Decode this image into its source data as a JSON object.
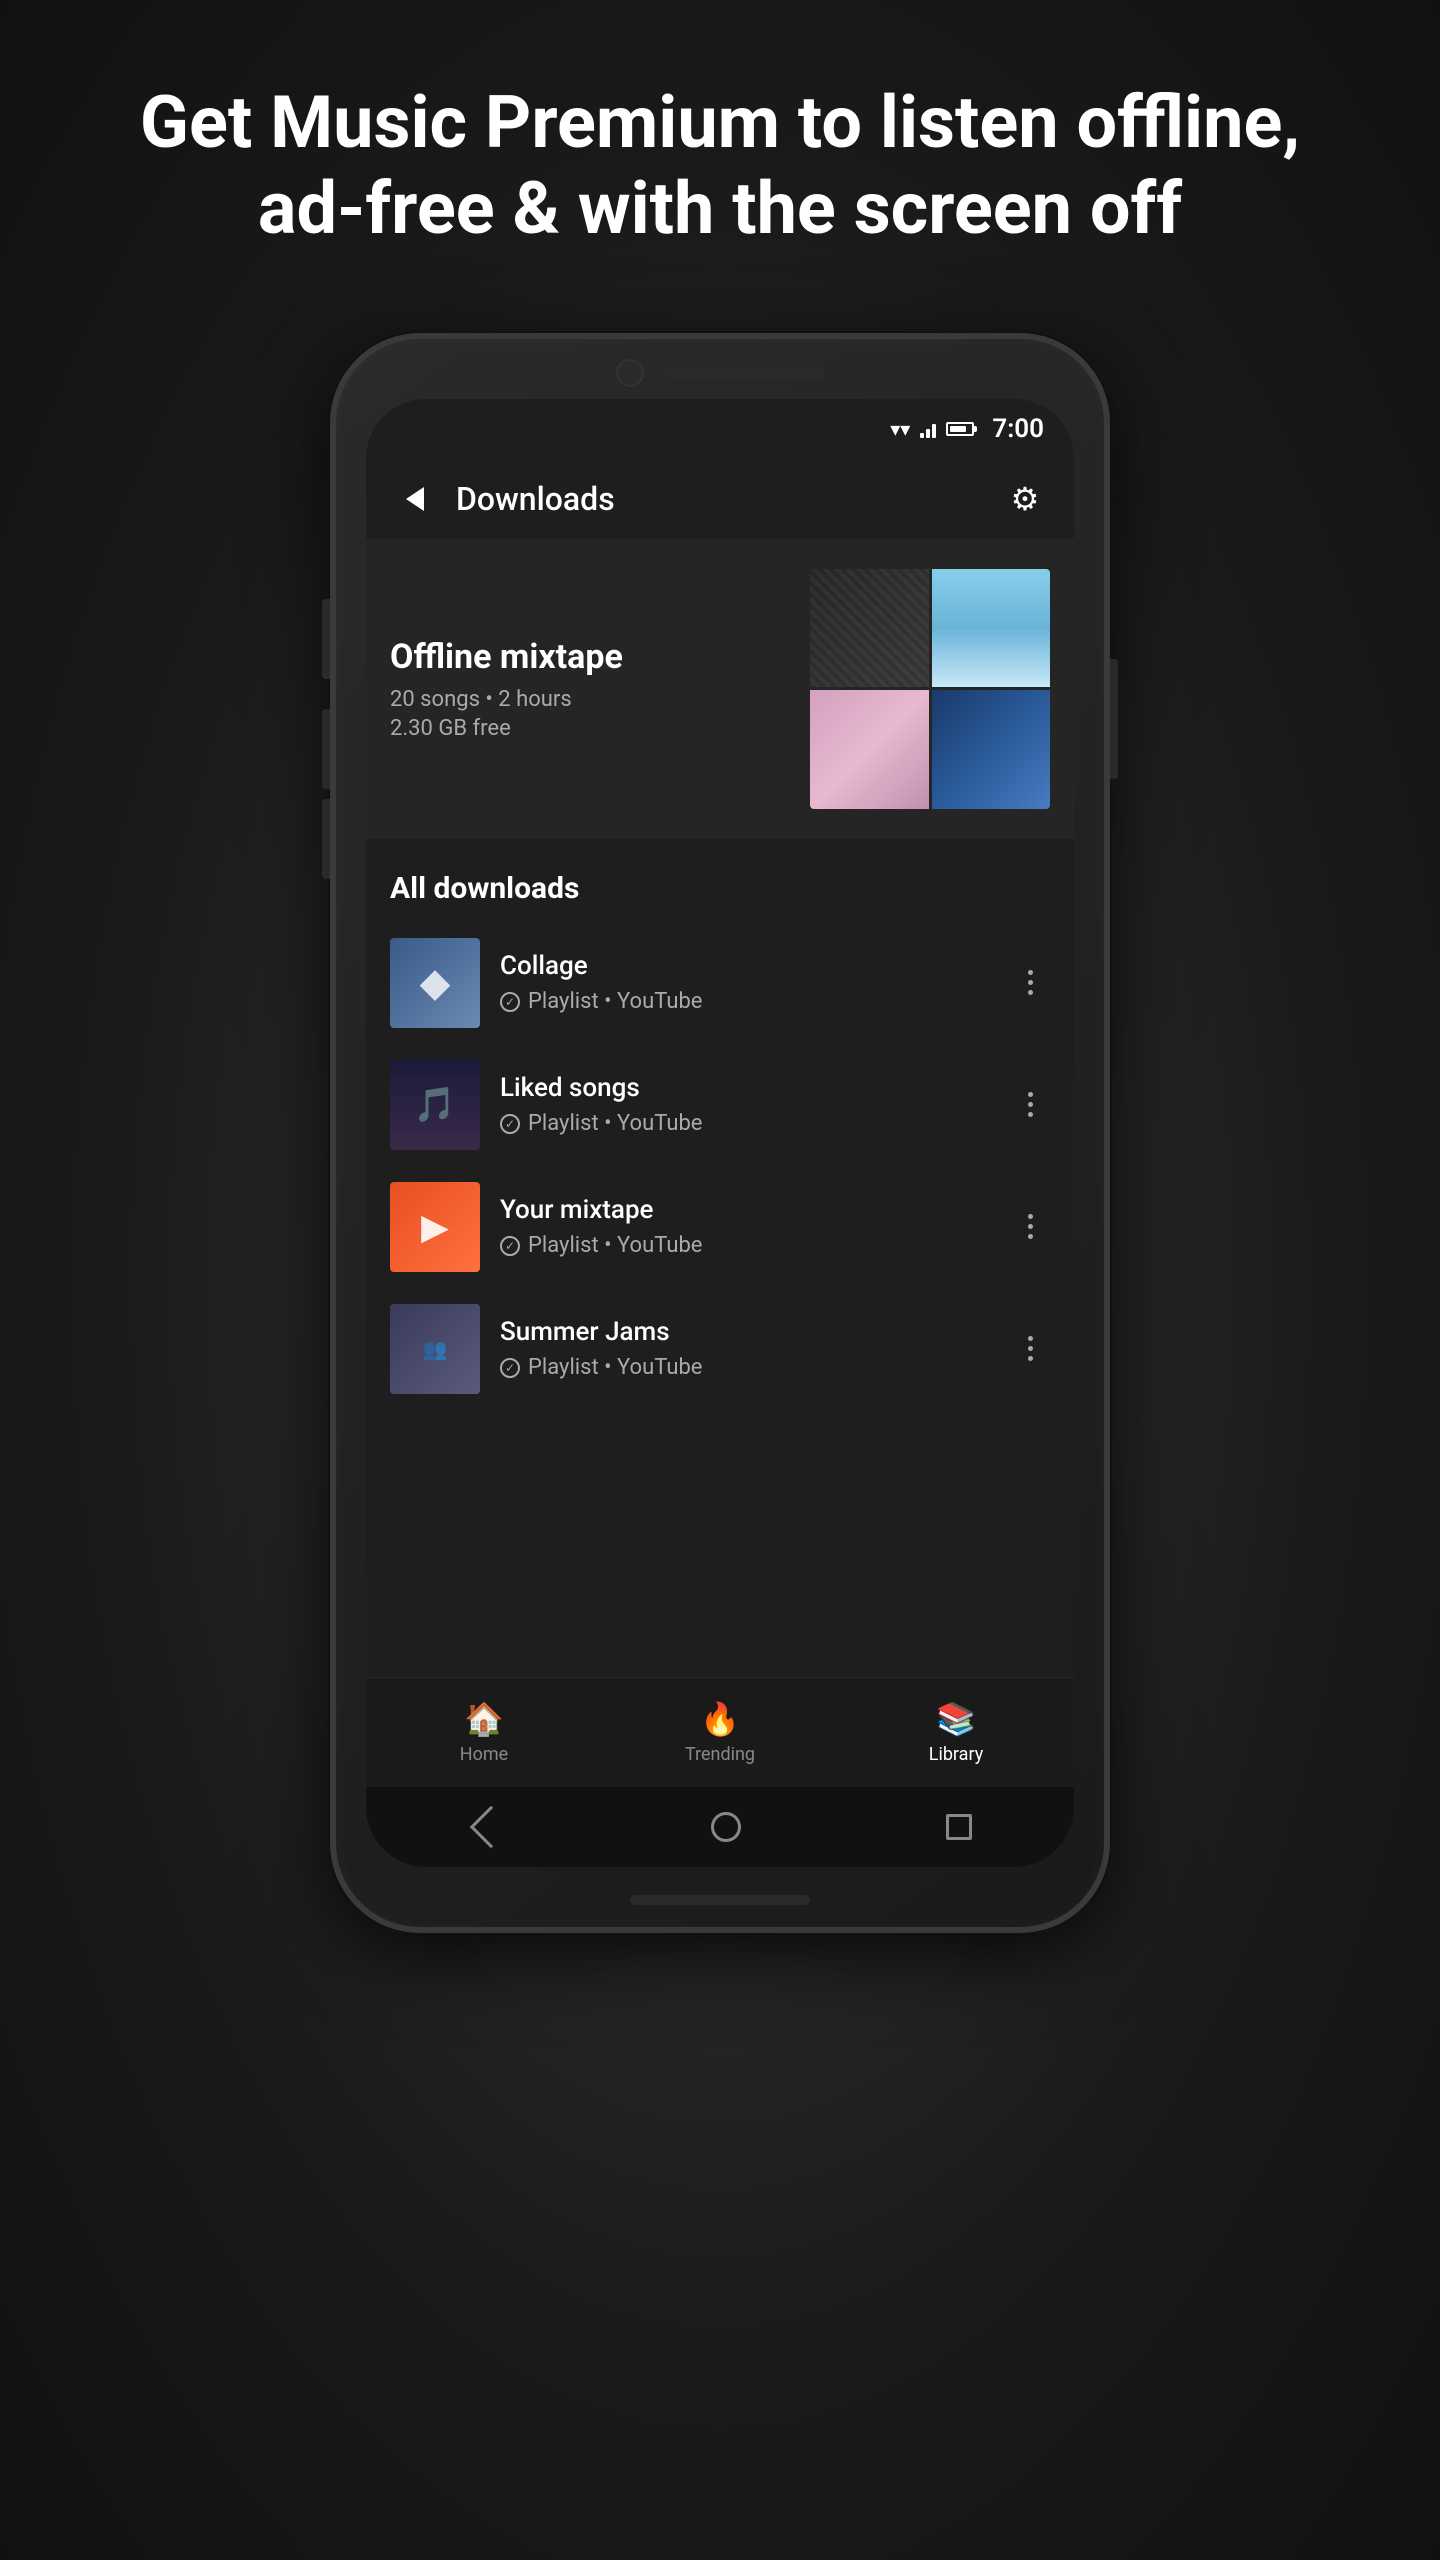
{
  "headline": "Get Music Premium to listen offline, ad-free & with the screen off",
  "status_bar": {
    "time": "7:00"
  },
  "header": {
    "title": "Downloads",
    "back_label": "back",
    "settings_label": "settings"
  },
  "offline_mixtape": {
    "title": "Offline mixtape",
    "songs": "20 songs",
    "duration": "2 hours",
    "storage": "2.30 GB free",
    "meta": "20 songs • 2 hours"
  },
  "all_downloads": {
    "section_title": "All downloads",
    "items": [
      {
        "name": "Collage",
        "sub": "Playlist • YouTube",
        "type": "collage"
      },
      {
        "name": "Liked songs",
        "sub": "Playlist • YouTube",
        "type": "liked"
      },
      {
        "name": "Your mixtape",
        "sub": "Playlist • YouTube",
        "type": "mixtape"
      },
      {
        "name": "Summer Jams",
        "sub": "Playlist • YouTube",
        "type": "summer"
      }
    ]
  },
  "bottom_nav": {
    "items": [
      {
        "label": "Home",
        "icon": "🏠",
        "active": false
      },
      {
        "label": "Trending",
        "icon": "🔥",
        "active": false
      },
      {
        "label": "Library",
        "icon": "📚",
        "active": true
      }
    ]
  }
}
